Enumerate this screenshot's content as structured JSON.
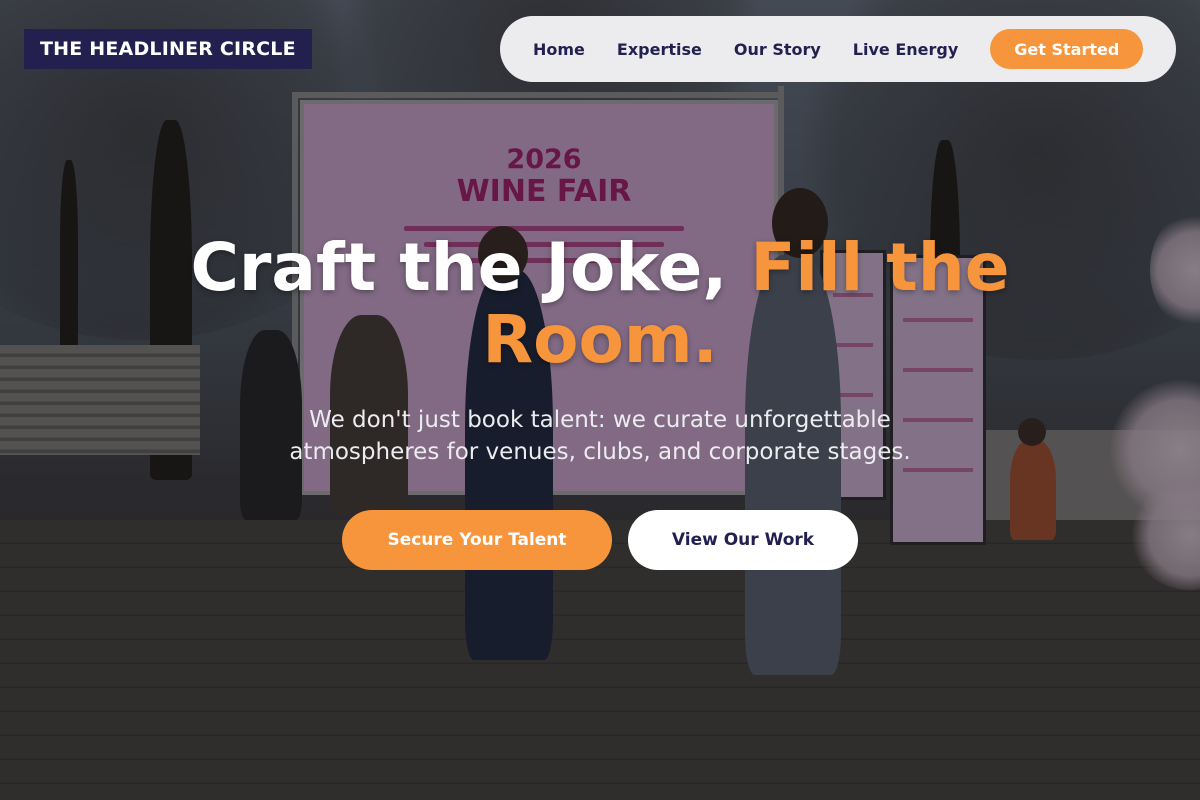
{
  "brand": {
    "logo_text": "THE HEADLINER CIRCLE"
  },
  "nav": {
    "links": [
      {
        "label": "Home"
      },
      {
        "label": "Expertise"
      },
      {
        "label": "Our Story"
      },
      {
        "label": "Live Energy"
      }
    ],
    "cta_label": "Get Started"
  },
  "hero": {
    "headline_main": "Craft the Joke, ",
    "headline_accent": "Fill the Room.",
    "subtitle": "We don't just book talent: we curate unforgettable atmospheres for venues, clubs, and corporate stages.",
    "primary_cta": "Secure Your Talent",
    "secondary_cta": "View Our Work"
  },
  "background_photo": {
    "banner_year": "2026",
    "banner_title": "WINE FAIR"
  },
  "colors": {
    "accent": "#f7953d",
    "brand_navy": "#231f4f",
    "nav_background": "#ececef"
  }
}
